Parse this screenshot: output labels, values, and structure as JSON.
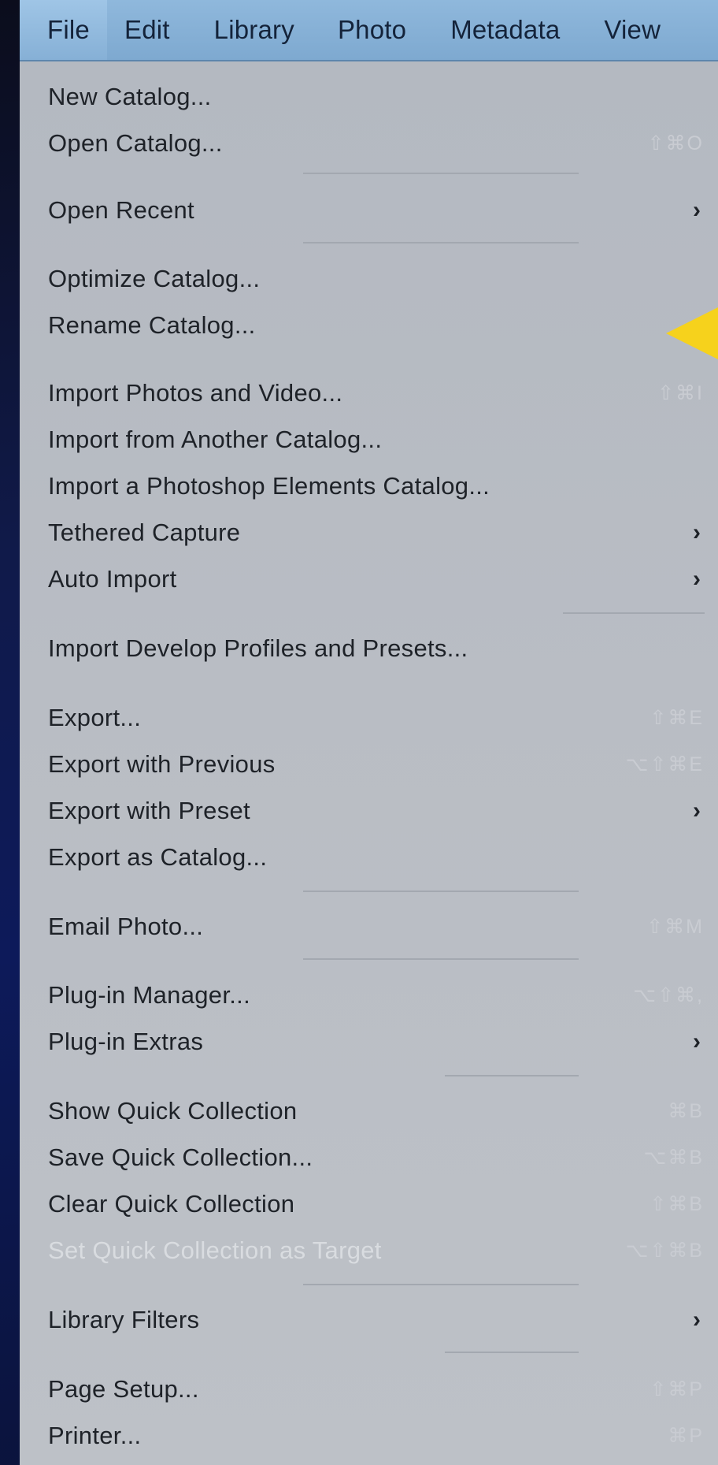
{
  "menubar": {
    "items": [
      {
        "label": "File"
      },
      {
        "label": "Edit"
      },
      {
        "label": "Library"
      },
      {
        "label": "Photo"
      },
      {
        "label": "Metadata"
      },
      {
        "label": "View"
      }
    ]
  },
  "file_menu": {
    "items": [
      {
        "label": "New Catalog...",
        "shortcut": ""
      },
      {
        "label": "Open Catalog...",
        "shortcut": "⇧⌘O"
      },
      {
        "label": "Open Recent",
        "submenu": true
      },
      {
        "label": "Optimize Catalog...",
        "shortcut": ""
      },
      {
        "label": "Rename Catalog...",
        "shortcut": ""
      },
      {
        "label": "Import Photos and Video...",
        "shortcut": "⇧⌘I"
      },
      {
        "label": "Import from Another Catalog...",
        "shortcut": ""
      },
      {
        "label": "Import a Photoshop Elements Catalog...",
        "shortcut": ""
      },
      {
        "label": "Tethered Capture",
        "submenu": true
      },
      {
        "label": "Auto Import",
        "submenu": true
      },
      {
        "label": "Import Develop Profiles and Presets...",
        "shortcut": ""
      },
      {
        "label": "Export...",
        "shortcut": "⇧⌘E"
      },
      {
        "label": "Export with Previous",
        "shortcut": "⌥⇧⌘E"
      },
      {
        "label": "Export with Preset",
        "submenu": true
      },
      {
        "label": "Export as Catalog...",
        "shortcut": ""
      },
      {
        "label": "Email Photo...",
        "shortcut": "⇧⌘M"
      },
      {
        "label": "Plug-in Manager...",
        "shortcut": "⌥⇧⌘,"
      },
      {
        "label": "Plug-in Extras",
        "submenu": true
      },
      {
        "label": "Show Quick Collection",
        "shortcut": "⌘B"
      },
      {
        "label": "Save Quick Collection...",
        "shortcut": "⌥⌘B"
      },
      {
        "label": "Clear Quick Collection",
        "shortcut": "⇧⌘B"
      },
      {
        "label": "Set Quick Collection as Target",
        "shortcut": "⌥⇧⌘B",
        "disabled": true
      },
      {
        "label": "Library Filters",
        "submenu": true
      },
      {
        "label": "Page Setup...",
        "shortcut": "⇧⌘P"
      },
      {
        "label": "Printer...",
        "shortcut": "⌘P"
      }
    ],
    "submenu_glyph": "›"
  },
  "annotation": {
    "pointer_color": "#f6d21c",
    "icon": "yellow-arrow-pointer"
  }
}
